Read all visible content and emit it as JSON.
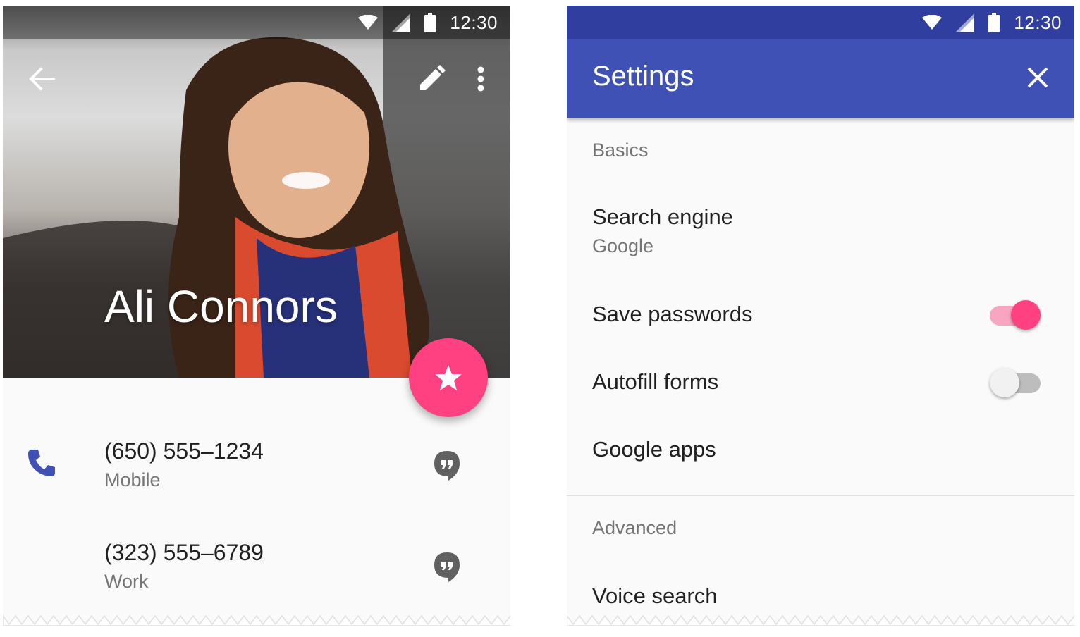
{
  "status": {
    "time": "12:30"
  },
  "contact": {
    "name": "Ali Connors",
    "phones": [
      {
        "number": "(650) 555–1234",
        "type": "Mobile"
      },
      {
        "number": "(323) 555–6789",
        "type": "Work"
      }
    ]
  },
  "settings": {
    "title": "Settings",
    "sections": [
      {
        "header": "Basics"
      },
      {
        "header": "Advanced"
      }
    ],
    "items": [
      {
        "label": "Search engine",
        "value": "Google"
      },
      {
        "label": "Save passwords",
        "toggle": true
      },
      {
        "label": "Autofill forms",
        "toggle": false
      },
      {
        "label": "Google apps"
      },
      {
        "label": "Voice search"
      }
    ]
  },
  "colors": {
    "primary": "#3f51b5",
    "primary_dark": "#303f9f",
    "accent": "#ff4081",
    "text_primary": "#212121",
    "text_secondary": "#757575",
    "phone_icon": "#3f51b5"
  },
  "icons": [
    "wifi-icon",
    "signal-icon",
    "battery-icon",
    "back-arrow-icon",
    "edit-icon",
    "more-vert-icon",
    "star-icon",
    "phone-icon",
    "hangouts-icon",
    "close-icon"
  ]
}
